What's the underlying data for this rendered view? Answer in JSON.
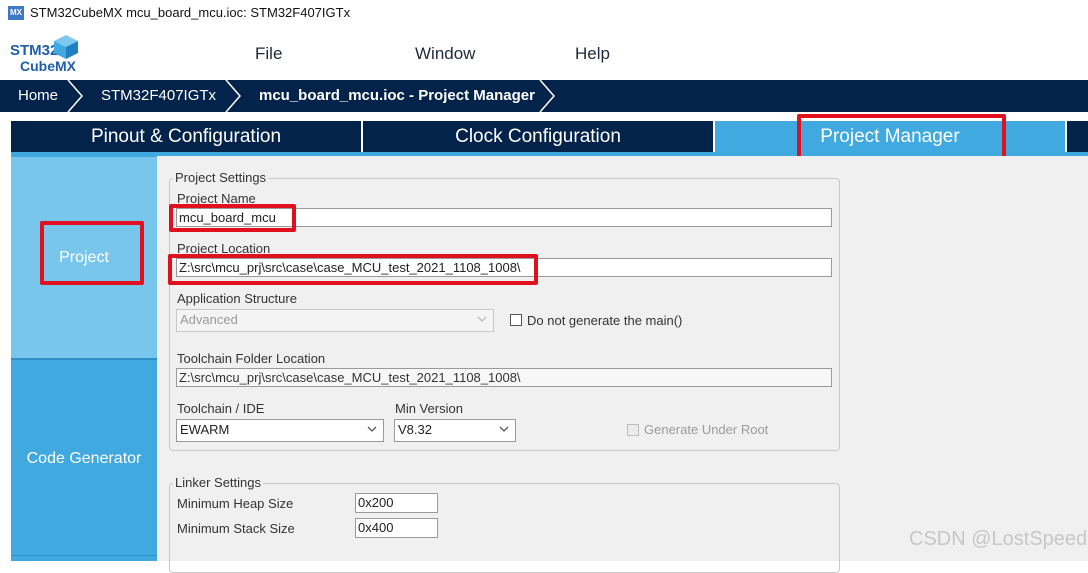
{
  "window": {
    "icon_text": "MX",
    "title": "STM32CubeMX mcu_board_mcu.ioc: STM32F407IGTx"
  },
  "logo": {
    "line1": "STM32",
    "line2": "CubeMX"
  },
  "menu": [
    "File",
    "Window",
    "Help"
  ],
  "breadcrumb": [
    "Home",
    "STM32F407IGTx",
    "mcu_board_mcu.ioc - Project Manager"
  ],
  "tabs": [
    "Pinout & Configuration",
    "Clock Configuration",
    "Project Manager"
  ],
  "active_tab": "Project Manager",
  "left_nav": [
    "Project",
    "Code Generator"
  ],
  "project_settings": {
    "legend": "Project Settings",
    "project_name_label": "Project Name",
    "project_name": "mcu_board_mcu",
    "project_location_label": "Project Location",
    "project_location": "Z:\\src\\mcu_prj\\src\\case\\case_MCU_test_2021_1108_1008\\",
    "app_structure_label": "Application Structure",
    "app_structure": "Advanced",
    "no_main_label": "Do not generate the main()",
    "toolchain_folder_label": "Toolchain Folder Location",
    "toolchain_folder": "Z:\\src\\mcu_prj\\src\\case\\case_MCU_test_2021_1108_1008\\",
    "toolchain_label": "Toolchain / IDE",
    "toolchain": "EWARM",
    "min_version_label": "Min Version",
    "min_version": "V8.32",
    "gen_under_root_label": "Generate Under Root"
  },
  "linker_settings": {
    "legend": "Linker Settings",
    "heap_label": "Minimum Heap Size",
    "heap": "0x200",
    "stack_label": "Minimum Stack Size",
    "stack": "0x400"
  },
  "watermark": "CSDN @LostSpeed",
  "colors": {
    "accent": "#3fa9e0",
    "breadcrumb_bg": "#03234b",
    "tab_bg": "#03234b",
    "highlight": "#e0101f"
  }
}
